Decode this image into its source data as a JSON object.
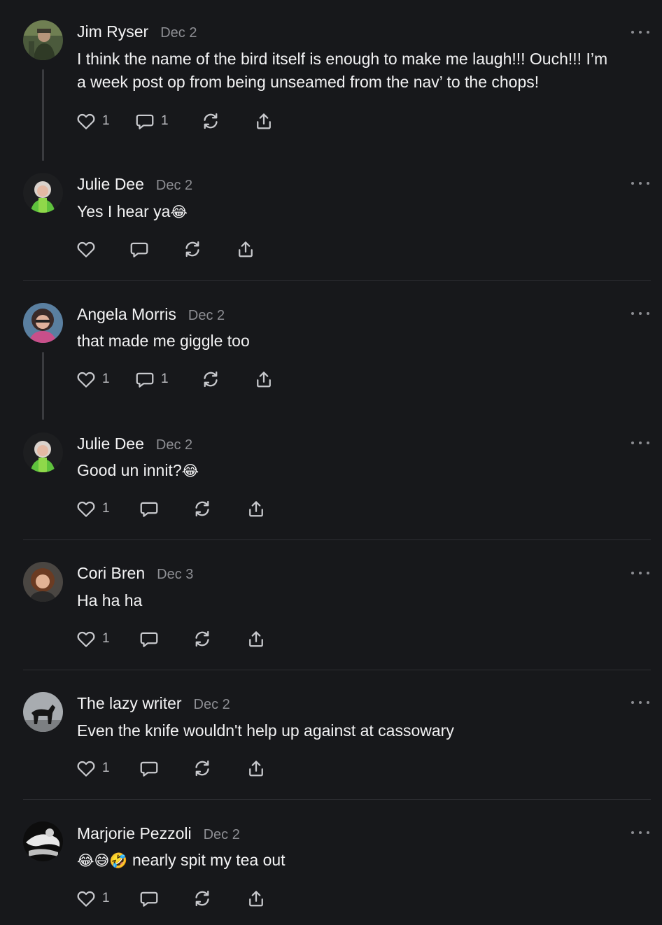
{
  "colors": {
    "background": "#17181b",
    "text": "#f2f2f3",
    "muted": "#8d8e93",
    "icon": "#c8c9cd",
    "divider": "#2d2e32"
  },
  "icons": {
    "like": "heart-icon",
    "reply": "comment-icon",
    "restack": "restack-icon",
    "share": "share-icon",
    "more": "more-icon"
  },
  "comments": [
    {
      "author": "Jim Ryser",
      "date": "Dec 2",
      "text_line1": "I think the name of the bird itself is enough to make me laugh!!! Ouch!!! I’m",
      "text_line2": "a week post op from being unseamed from the nav’ to the chops!",
      "likes": "1",
      "replies": "1"
    },
    {
      "author": "Julie Dee",
      "date": "Dec 2",
      "text": "Yes I hear ya",
      "emoji": "😂",
      "likes": "",
      "replies": ""
    },
    {
      "author": "Angela Morris",
      "date": "Dec 2",
      "text": "that made me giggle too",
      "likes": "1",
      "replies": "1"
    },
    {
      "author": "Julie Dee",
      "date": "Dec 2",
      "text": "Good un innit?",
      "emoji": "😂",
      "likes": "1",
      "replies": ""
    },
    {
      "author": "Cori Bren",
      "date": "Dec 3",
      "text": "Ha ha ha",
      "likes": "1",
      "replies": ""
    },
    {
      "author": "The lazy writer",
      "date": "Dec 2",
      "text": "Even the knife wouldn't help up against at cassowary",
      "likes": "1",
      "replies": ""
    },
    {
      "author": "Marjorie Pezzoli",
      "date": "Dec 2",
      "emoji": "😂😅🤣",
      "text": " nearly spit my tea out",
      "likes": "1",
      "replies": ""
    }
  ]
}
